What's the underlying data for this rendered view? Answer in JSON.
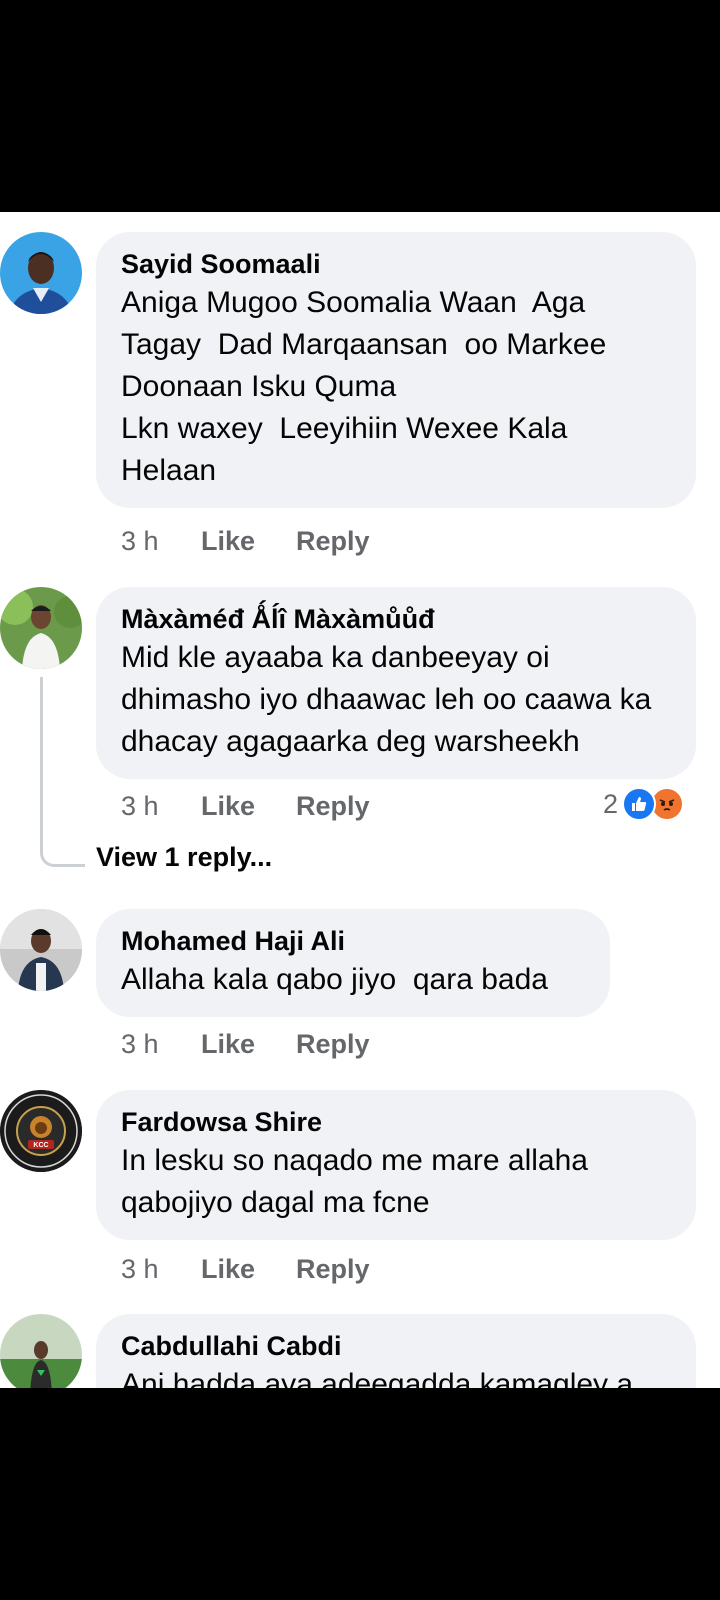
{
  "comments": [
    {
      "author": "Sayid Soomaali",
      "text": "Aniga Mugoo Soomalia Waan  Aga Tagay  Dad Marqaansan  oo Markee Doonaan Isku Quma\nLkn waxey  Leeyihiin Wexee Kala Helaan",
      "time": "3 h",
      "like": "Like",
      "reply": "Reply"
    },
    {
      "author": "Màxàméđ Ǻĺî Màxàmůůđ",
      "text": "Mid kle ayaaba ka danbeeyay oi dhimasho iyo dhaawac leh oo caawa ka dhacay agagaarka deg warsheekh",
      "time": "3 h",
      "like": "Like",
      "reply": "Reply",
      "reaction_count": "2",
      "reaction_icons": [
        "like-icon",
        "angry-icon"
      ],
      "view_replies": "View 1 reply..."
    },
    {
      "author": "Mohamed Haji Ali",
      "text": "Allaha kala qabo jiyo  qara bada",
      "time": "3 h",
      "like": "Like",
      "reply": "Reply"
    },
    {
      "author": "Fardowsa Shire",
      "text": "In lesku so naqado me mare allaha qabojiyo dagal ma fcne",
      "time": "3 h",
      "like": "Like",
      "reply": "Reply",
      "avatar_text": {
        "top": "CELI CUMAR EMPIRE",
        "bottom": "POLORTOYO CELI CUMAR",
        "badge": "KCC"
      }
    },
    {
      "author": "Cabdullahi Cabdi",
      "text": "Ani hadda aya adeegadda kamagley a"
    }
  ],
  "colors": {
    "bubble": "#f0f2f5",
    "meta": "#65676b",
    "like_blue": "#1877f2",
    "angry_orange": "#f0742d"
  }
}
